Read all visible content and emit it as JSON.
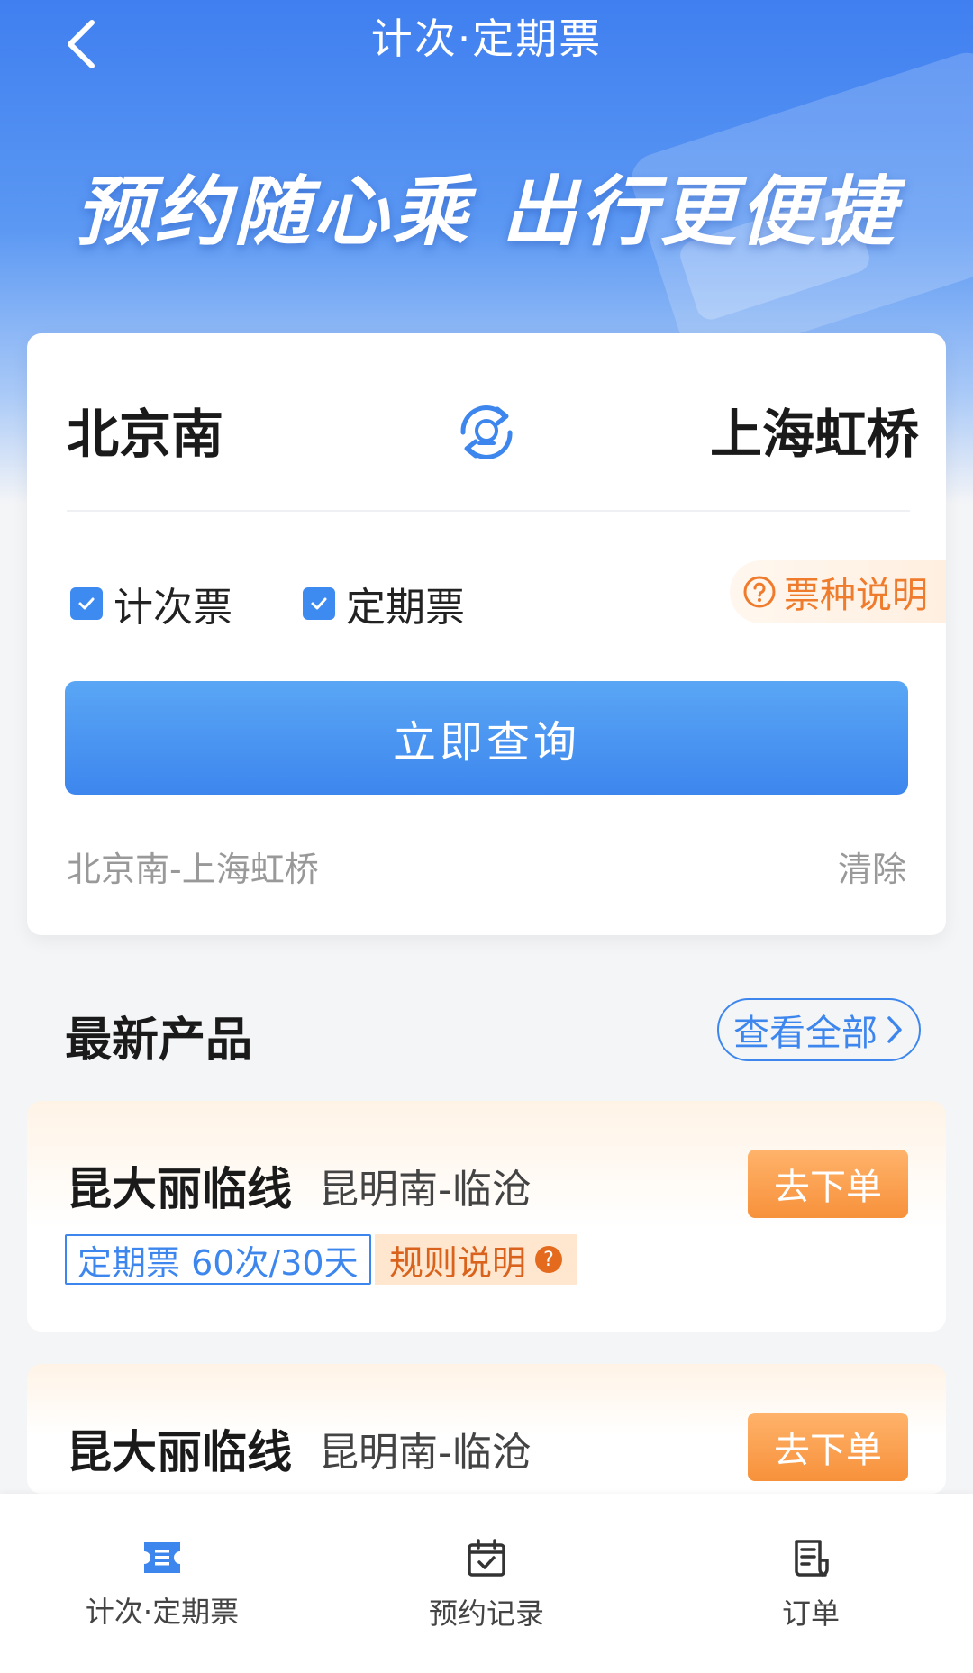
{
  "header": {
    "title": "计次·定期票",
    "slogan": "预约随心乘 出行更便捷"
  },
  "search": {
    "from_station": "北京南",
    "to_station": "上海虹桥",
    "ticket_types": [
      {
        "label": "计次票",
        "checked": true
      },
      {
        "label": "定期票",
        "checked": true
      }
    ],
    "type_help_label": "票种说明",
    "query_button": "立即查询",
    "history_item": "北京南-上海虹桥",
    "clear_label": "清除"
  },
  "products": {
    "section_title": "最新产品",
    "view_all": "查看全部",
    "items": [
      {
        "line": "昆大丽临线",
        "route": "昆明南-临沧",
        "order_button": "去下单",
        "ticket_tag": "定期票 60次/30天",
        "rules_label": "规则说明"
      },
      {
        "line": "昆大丽临线",
        "route": "昆明南-临沧",
        "order_button": "去下单"
      }
    ]
  },
  "tabbar": {
    "tabs": [
      {
        "label": "计次·定期票",
        "active": true
      },
      {
        "label": "预约记录",
        "active": false
      },
      {
        "label": "订单",
        "active": false
      }
    ]
  },
  "colors": {
    "primary": "#3d86ee",
    "accent_orange": "#f7913b"
  }
}
